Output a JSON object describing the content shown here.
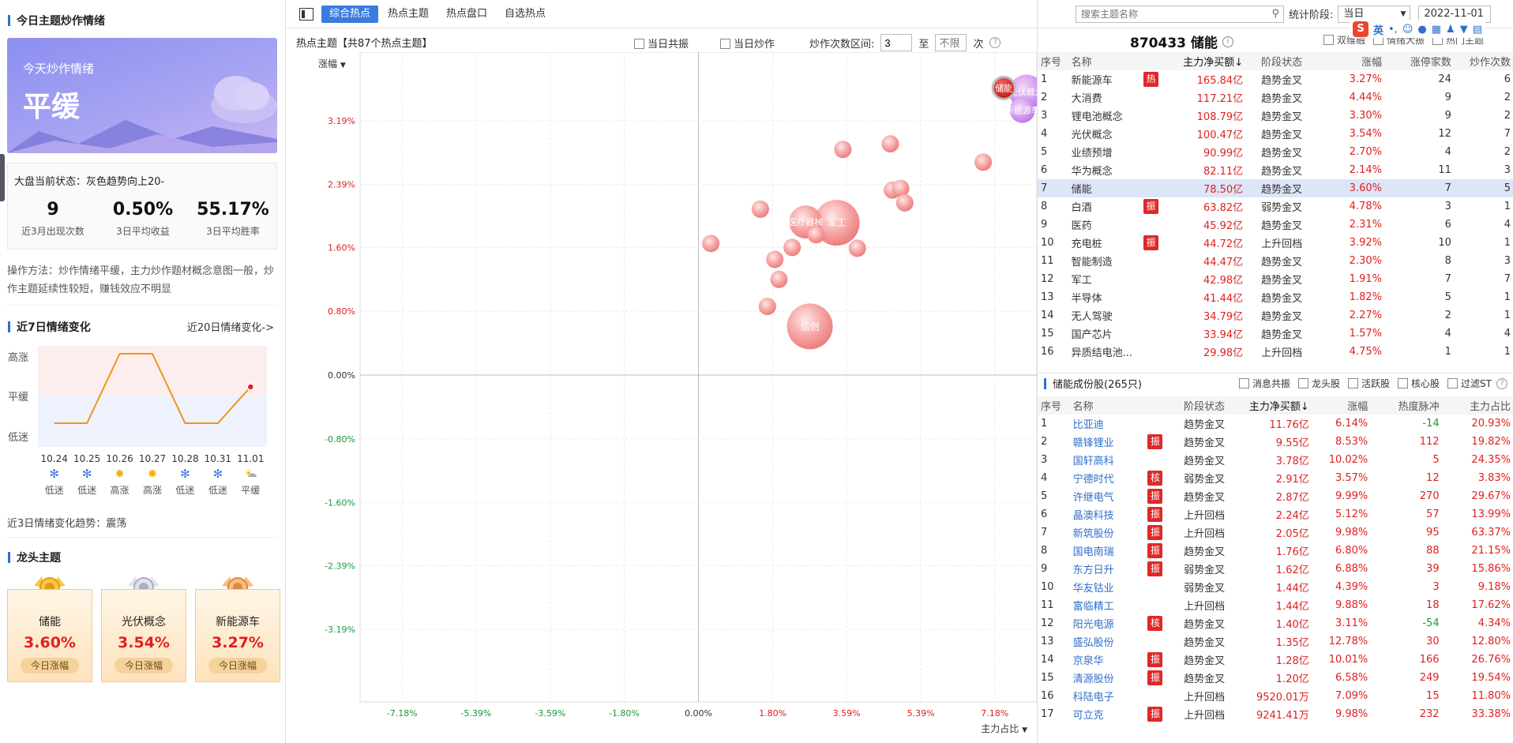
{
  "left": {
    "title": "今日主题炒作情绪",
    "banner_small": "今天炒作情绪",
    "banner_big": "平缓",
    "status_line": "大盘当前状态：灰色趋势向上20-",
    "stats": [
      {
        "value": "9",
        "label": "近3月出现次数"
      },
      {
        "value": "0.50%",
        "label": "3日平均收益"
      },
      {
        "value": "55.17%",
        "label": "3日平均胜率"
      }
    ],
    "method": "操作方法：炒作情绪平缓，主力炒作题材概念意图一般，炒作主题延续性较短，赚钱效应不明显",
    "week_title": "近7日情绪变化",
    "week_link": "近20日情绪变化->",
    "levels": [
      "高涨",
      "平缓",
      "低迷"
    ],
    "days": [
      {
        "date": "10.24",
        "mood": "低迷",
        "icon": "snow-icon"
      },
      {
        "date": "10.25",
        "mood": "低迷",
        "icon": "snow-icon"
      },
      {
        "date": "10.26",
        "mood": "高涨",
        "icon": "sun-icon"
      },
      {
        "date": "10.27",
        "mood": "高涨",
        "icon": "sun-icon"
      },
      {
        "date": "10.28",
        "mood": "低迷",
        "icon": "snow-icon"
      },
      {
        "date": "10.31",
        "mood": "低迷",
        "icon": "snow-icon"
      },
      {
        "date": "11.01",
        "mood": "平缓",
        "icon": "cloud-icon"
      }
    ],
    "trend3": "近3日情绪变化趋势：震荡",
    "leader_title": "龙头主题",
    "leaders": [
      {
        "name": "储能",
        "pct": "3.60%",
        "btn": "今日涨幅",
        "medal": "gold"
      },
      {
        "name": "光伏概念",
        "pct": "3.54%",
        "btn": "今日涨幅",
        "medal": "silver"
      },
      {
        "name": "新能源车",
        "pct": "3.27%",
        "btn": "今日涨幅",
        "medal": "bronze"
      }
    ]
  },
  "toolbar": {
    "tabs": [
      "综合热点",
      "热点主题",
      "热点盘口",
      "自选热点"
    ],
    "search_placeholder": "搜索主题名称",
    "period_label": "统计阶段:",
    "period_value": "当日",
    "date": "2022-11-01"
  },
  "chart_panel": {
    "title": "热点主题【共87个热点主题】",
    "opt1": "当日共振",
    "opt2": "当日炒作",
    "range_label": "炒作次数区间:",
    "range_from": "3",
    "range_to_word": "至",
    "range_to_placeholder": "不限",
    "range_unit": "次",
    "y_selector": "涨幅",
    "x_selector": "主力占比"
  },
  "chart_data": {
    "type": "scatter",
    "xlabel": "主力占比",
    "ylabel": "涨幅",
    "xlim": [
      -8.2,
      8.2
    ],
    "ylim": [
      -4.1,
      4.05
    ],
    "x_ticks": [
      "-7.18%",
      "-5.39%",
      "-3.59%",
      "-1.80%",
      "0.00%",
      "1.80%",
      "3.59%",
      "5.39%",
      "7.18%"
    ],
    "x_tick_values": [
      -7.18,
      -5.39,
      -3.59,
      -1.8,
      0,
      1.8,
      3.59,
      5.39,
      7.18
    ],
    "y_ticks": [
      "3.19%",
      "2.39%",
      "1.60%",
      "0.80%",
      "0.00%",
      "-0.80%",
      "-1.60%",
      "-2.39%",
      "-3.19%"
    ],
    "y_tick_values": [
      3.19,
      2.39,
      1.6,
      0.8,
      0,
      -0.8,
      -1.6,
      -2.39,
      -3.19
    ],
    "points": [
      {
        "x": 7.4,
        "y": 3.6,
        "r": 14,
        "label": "储能",
        "hl": "dark"
      },
      {
        "x": 7.95,
        "y": 3.55,
        "r": 22,
        "label": "光伏概念",
        "hl": "purple"
      },
      {
        "x": 7.85,
        "y": 3.32,
        "r": 16,
        "label": "新能源车",
        "hl": "purple"
      },
      {
        "x": 2.6,
        "y": 1.92,
        "r": 21,
        "label": "医疗器械服务",
        "hl": ""
      },
      {
        "x": 3.35,
        "y": 1.91,
        "r": 29,
        "label": "军工",
        "hl": ""
      },
      {
        "x": 2.7,
        "y": 0.61,
        "r": 29,
        "label": "信创",
        "hl": ""
      },
      {
        "x": 0.3,
        "y": 1.65,
        "r": 11,
        "label": "",
        "hl": ""
      },
      {
        "x": 1.5,
        "y": 2.08,
        "r": 11,
        "label": "",
        "hl": ""
      },
      {
        "x": 1.85,
        "y": 1.45,
        "r": 11,
        "label": "",
        "hl": ""
      },
      {
        "x": 1.95,
        "y": 1.2,
        "r": 11,
        "label": "",
        "hl": ""
      },
      {
        "x": 2.27,
        "y": 1.6,
        "r": 11,
        "label": "",
        "hl": ""
      },
      {
        "x": 1.67,
        "y": 0.86,
        "r": 11,
        "label": "",
        "hl": ""
      },
      {
        "x": 2.85,
        "y": 1.76,
        "r": 11,
        "label": "",
        "hl": ""
      },
      {
        "x": 3.5,
        "y": 2.83,
        "r": 11,
        "label": "",
        "hl": ""
      },
      {
        "x": 4.65,
        "y": 2.9,
        "r": 11,
        "label": "",
        "hl": ""
      },
      {
        "x": 4.7,
        "y": 2.32,
        "r": 11,
        "label": "",
        "hl": ""
      },
      {
        "x": 4.9,
        "y": 2.34,
        "r": 11,
        "label": "",
        "hl": ""
      },
      {
        "x": 5.0,
        "y": 2.16,
        "r": 11,
        "label": "",
        "hl": ""
      },
      {
        "x": 3.85,
        "y": 1.59,
        "r": 11,
        "label": "",
        "hl": ""
      },
      {
        "x": 6.9,
        "y": 2.67,
        "r": 11,
        "label": "",
        "hl": ""
      }
    ]
  },
  "topics": {
    "title": "870433 储能",
    "check1": "双维融",
    "check2": "情绪大振",
    "check3": "热门主题",
    "headers": [
      "序号",
      "名称",
      "主力净买额↓",
      "阶段状态",
      "涨幅",
      "涨停家数",
      "炒作次数"
    ],
    "rows": [
      {
        "no": "1",
        "name": "新能源车",
        "badge": "热",
        "net": "165.84亿",
        "stage": "趋势金叉",
        "pct": "3.27%",
        "lim": "24",
        "times": "6"
      },
      {
        "no": "2",
        "name": "大消费",
        "badge": "",
        "net": "117.21亿",
        "stage": "趋势金叉",
        "pct": "4.44%",
        "lim": "9",
        "times": "2"
      },
      {
        "no": "3",
        "name": "锂电池概念",
        "badge": "",
        "net": "108.79亿",
        "stage": "趋势金叉",
        "pct": "3.30%",
        "lim": "9",
        "times": "2"
      },
      {
        "no": "4",
        "name": "光伏概念",
        "badge": "",
        "net": "100.47亿",
        "stage": "趋势金叉",
        "pct": "3.54%",
        "lim": "12",
        "times": "7"
      },
      {
        "no": "5",
        "name": "业绩预增",
        "badge": "",
        "net": "90.99亿",
        "stage": "趋势金叉",
        "pct": "2.70%",
        "lim": "4",
        "times": "2"
      },
      {
        "no": "6",
        "name": "华为概念",
        "badge": "",
        "net": "82.11亿",
        "stage": "趋势金叉",
        "pct": "2.14%",
        "lim": "11",
        "times": "3"
      },
      {
        "no": "7",
        "name": "储能",
        "badge": "",
        "net": "78.50亿",
        "stage": "趋势金叉",
        "pct": "3.60%",
        "lim": "7",
        "times": "5",
        "sel": true
      },
      {
        "no": "8",
        "name": "白酒",
        "badge": "振",
        "net": "63.82亿",
        "stage": "弱势金叉",
        "pct": "4.78%",
        "lim": "3",
        "times": "1"
      },
      {
        "no": "9",
        "name": "医药",
        "badge": "",
        "net": "45.92亿",
        "stage": "趋势金叉",
        "pct": "2.31%",
        "lim": "6",
        "times": "4"
      },
      {
        "no": "10",
        "name": "充电桩",
        "badge": "振",
        "net": "44.72亿",
        "stage": "上升回档",
        "pct": "3.92%",
        "lim": "10",
        "times": "1"
      },
      {
        "no": "11",
        "name": "智能制造",
        "badge": "",
        "net": "44.47亿",
        "stage": "趋势金叉",
        "pct": "2.30%",
        "lim": "8",
        "times": "3"
      },
      {
        "no": "12",
        "name": "军工",
        "badge": "",
        "net": "42.98亿",
        "stage": "趋势金叉",
        "pct": "1.91%",
        "lim": "7",
        "times": "7"
      },
      {
        "no": "13",
        "name": "半导体",
        "badge": "",
        "net": "41.44亿",
        "stage": "趋势金叉",
        "pct": "1.82%",
        "lim": "5",
        "times": "1"
      },
      {
        "no": "14",
        "name": "无人驾驶",
        "badge": "",
        "net": "34.79亿",
        "stage": "趋势金叉",
        "pct": "2.27%",
        "lim": "2",
        "times": "1"
      },
      {
        "no": "15",
        "name": "国产芯片",
        "badge": "",
        "net": "33.94亿",
        "stage": "趋势金叉",
        "pct": "1.57%",
        "lim": "4",
        "times": "4"
      },
      {
        "no": "16",
        "name": "异质结电池...",
        "badge": "",
        "net": "29.98亿",
        "stage": "上升回档",
        "pct": "4.75%",
        "lim": "1",
        "times": "1"
      }
    ]
  },
  "stocks": {
    "title": "储能成份股(265只)",
    "filters": [
      "消息共振",
      "龙头股",
      "活跃股",
      "核心股",
      "过滤ST"
    ],
    "headers": [
      "序号",
      "名称",
      "阶段状态",
      "主力净买额↓",
      "涨幅",
      "热度脉冲",
      "主力占比"
    ],
    "rows": [
      {
        "no": "1",
        "name": "比亚迪",
        "badge": "",
        "stage": "趋势金叉",
        "net": "11.76亿",
        "pct": "6.14%",
        "heat": "-14",
        "ratio": "20.93%"
      },
      {
        "no": "2",
        "name": "赣锋锂业",
        "badge": "振",
        "stage": "趋势金叉",
        "net": "9.55亿",
        "pct": "8.53%",
        "heat": "112",
        "ratio": "19.82%"
      },
      {
        "no": "3",
        "name": "国轩高科",
        "badge": "",
        "stage": "趋势金叉",
        "net": "3.78亿",
        "pct": "10.02%",
        "heat": "5",
        "ratio": "24.35%"
      },
      {
        "no": "4",
        "name": "宁德时代",
        "badge": "核",
        "stage": "弱势金叉",
        "net": "2.91亿",
        "pct": "3.57%",
        "heat": "12",
        "ratio": "3.83%"
      },
      {
        "no": "5",
        "name": "许继电气",
        "badge": "振",
        "stage": "趋势金叉",
        "net": "2.87亿",
        "pct": "9.99%",
        "heat": "270",
        "ratio": "29.67%"
      },
      {
        "no": "6",
        "name": "晶澳科技",
        "badge": "振",
        "stage": "上升回档",
        "net": "2.24亿",
        "pct": "5.12%",
        "heat": "57",
        "ratio": "13.99%"
      },
      {
        "no": "7",
        "name": "新筑股份",
        "badge": "振",
        "stage": "上升回档",
        "net": "2.05亿",
        "pct": "9.98%",
        "heat": "95",
        "ratio": "63.37%"
      },
      {
        "no": "8",
        "name": "国电南瑞",
        "badge": "振",
        "stage": "趋势金叉",
        "net": "1.76亿",
        "pct": "6.80%",
        "heat": "88",
        "ratio": "21.15%"
      },
      {
        "no": "9",
        "name": "东方日升",
        "badge": "振",
        "stage": "弱势金叉",
        "net": "1.62亿",
        "pct": "6.88%",
        "heat": "39",
        "ratio": "15.86%"
      },
      {
        "no": "10",
        "name": "华友钴业",
        "badge": "",
        "stage": "弱势金叉",
        "net": "1.44亿",
        "pct": "4.39%",
        "heat": "3",
        "ratio": "9.18%"
      },
      {
        "no": "11",
        "name": "富临精工",
        "badge": "",
        "stage": "上升回档",
        "net": "1.44亿",
        "pct": "9.88%",
        "heat": "18",
        "ratio": "17.62%"
      },
      {
        "no": "12",
        "name": "阳光电源",
        "badge": "核",
        "stage": "趋势金叉",
        "net": "1.40亿",
        "pct": "3.11%",
        "heat": "-54",
        "ratio": "4.34%"
      },
      {
        "no": "13",
        "name": "盛弘股份",
        "badge": "",
        "stage": "趋势金叉",
        "net": "1.35亿",
        "pct": "12.78%",
        "heat": "30",
        "ratio": "12.80%"
      },
      {
        "no": "14",
        "name": "京泉华",
        "badge": "振",
        "stage": "趋势金叉",
        "net": "1.28亿",
        "pct": "10.01%",
        "heat": "166",
        "ratio": "26.76%"
      },
      {
        "no": "15",
        "name": "清源股份",
        "badge": "振",
        "stage": "趋势金叉",
        "net": "1.20亿",
        "pct": "6.58%",
        "heat": "249",
        "ratio": "19.54%"
      },
      {
        "no": "16",
        "name": "科陆电子",
        "badge": "",
        "stage": "上升回档",
        "net": "9520.01万",
        "pct": "7.09%",
        "heat": "15",
        "ratio": "11.80%"
      },
      {
        "no": "17",
        "name": "可立克",
        "badge": "振",
        "stage": "上升回档",
        "net": "9241.41万",
        "pct": "9.98%",
        "heat": "232",
        "ratio": "33.38%"
      }
    ]
  }
}
